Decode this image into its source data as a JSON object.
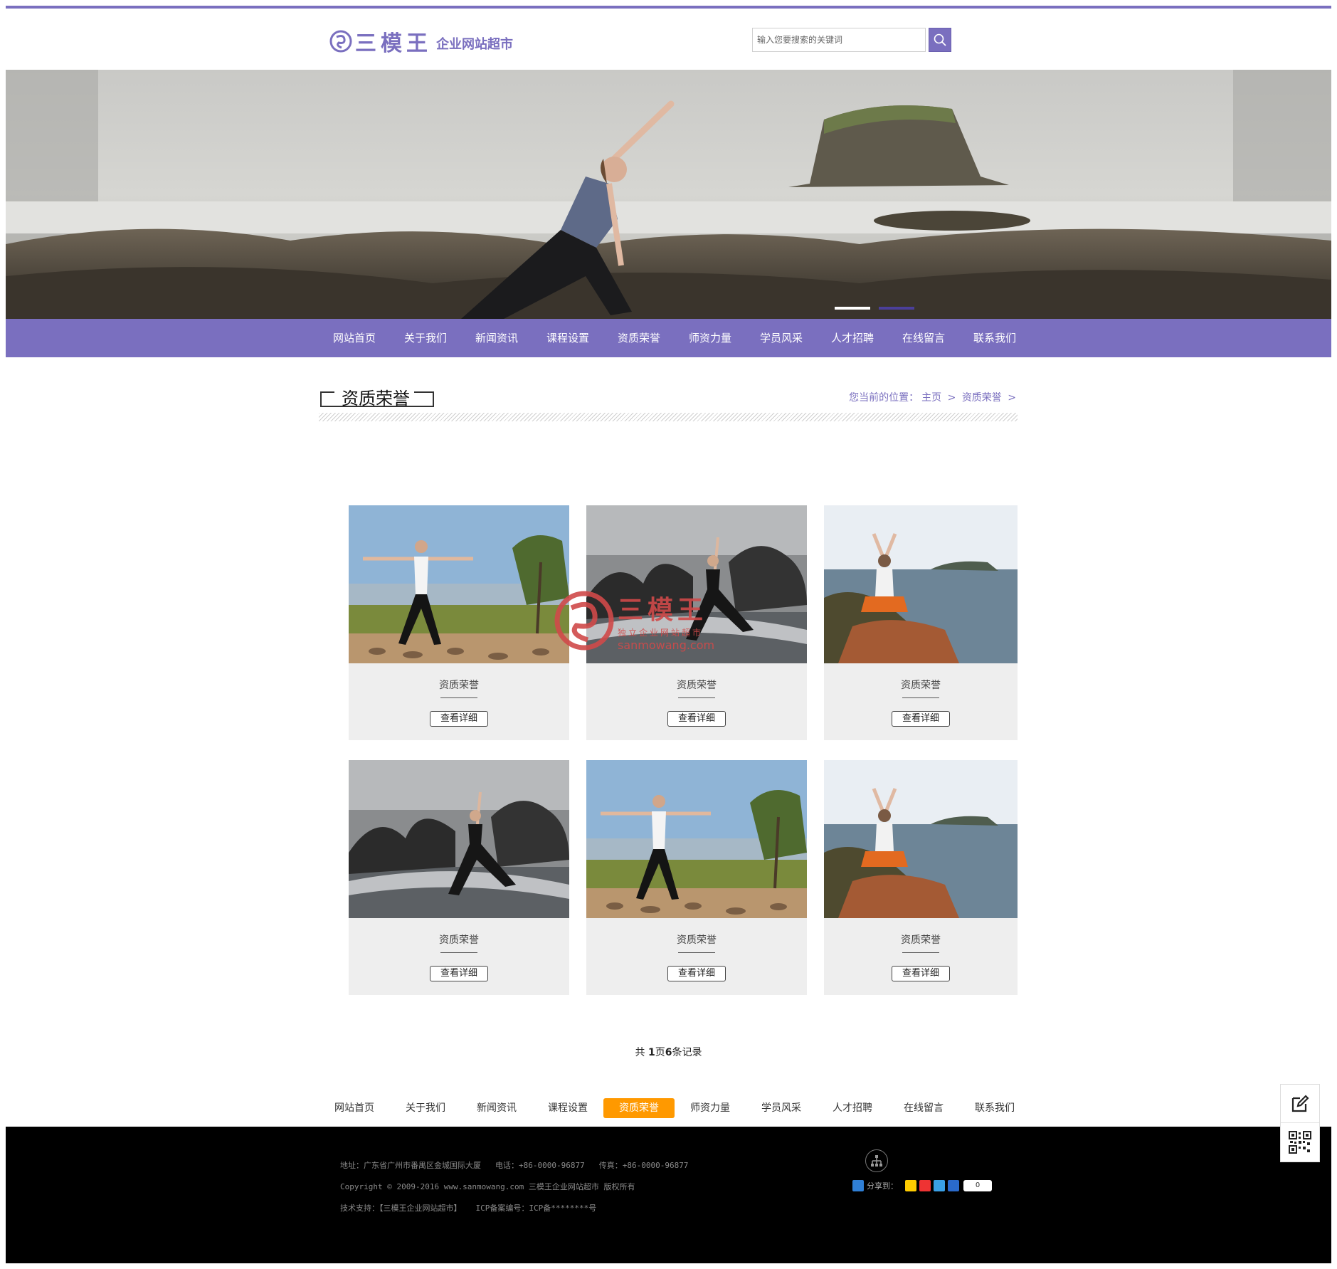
{
  "header": {
    "brand": "三模王",
    "tagline": "企业网站超市",
    "search_placeholder": "输入您要搜索的关键词"
  },
  "nav": [
    "网站首页",
    "关于我们",
    "新闻资讯",
    "课程设置",
    "资质荣誉",
    "师资力量",
    "学员风采",
    "人才招聘",
    "在线留言",
    "联系我们"
  ],
  "section": {
    "title": "资质荣誉",
    "crumb_prefix": "您当前的位置：",
    "crumb_home": "主页",
    "crumb_current": "资质荣誉",
    "crumb_sep": ">"
  },
  "watermark": {
    "brand": "三模王",
    "sub": "独立企业网站超市",
    "url": "sanmowang.com"
  },
  "cards": [
    {
      "caption": "资质荣誉",
      "button": "查看详细",
      "image": "yoga-warrior-field"
    },
    {
      "caption": "资质荣誉",
      "button": "查看详细",
      "image": "yoga-rocks-water"
    },
    {
      "caption": "资质荣誉",
      "button": "查看详细",
      "image": "yoga-sea-sitting"
    },
    {
      "caption": "资质荣誉",
      "button": "查看详细",
      "image": "yoga-rocks-water"
    },
    {
      "caption": "资质荣誉",
      "button": "查看详细",
      "image": "yoga-warrior-field"
    },
    {
      "caption": "资质荣誉",
      "button": "查看详细",
      "image": "yoga-sea-sitting"
    }
  ],
  "pager": {
    "prefix": "共 ",
    "pages": "1",
    "mid": "页",
    "count": "6",
    "suffix": "条记录"
  },
  "bottom_nav_active": "资质荣誉",
  "footer": {
    "address": "地址：广东省广州市番禺区金城国际大厦",
    "phone": "电话：+86-0000-96877",
    "fax": "传真：+86-0000-96877",
    "copyright": "Copyright © 2009-2016 www.sanmowang.com 三模王企业网站超市 版权所有",
    "support": "技术支持：【三模王企业网站超市】",
    "icp": "ICP备案编号：ICP备********号",
    "share_label": "分享到：",
    "share_count": "0"
  },
  "colors": {
    "accent": "#7a6fbf",
    "active": "#ff9900",
    "footer_bg": "#000000"
  }
}
